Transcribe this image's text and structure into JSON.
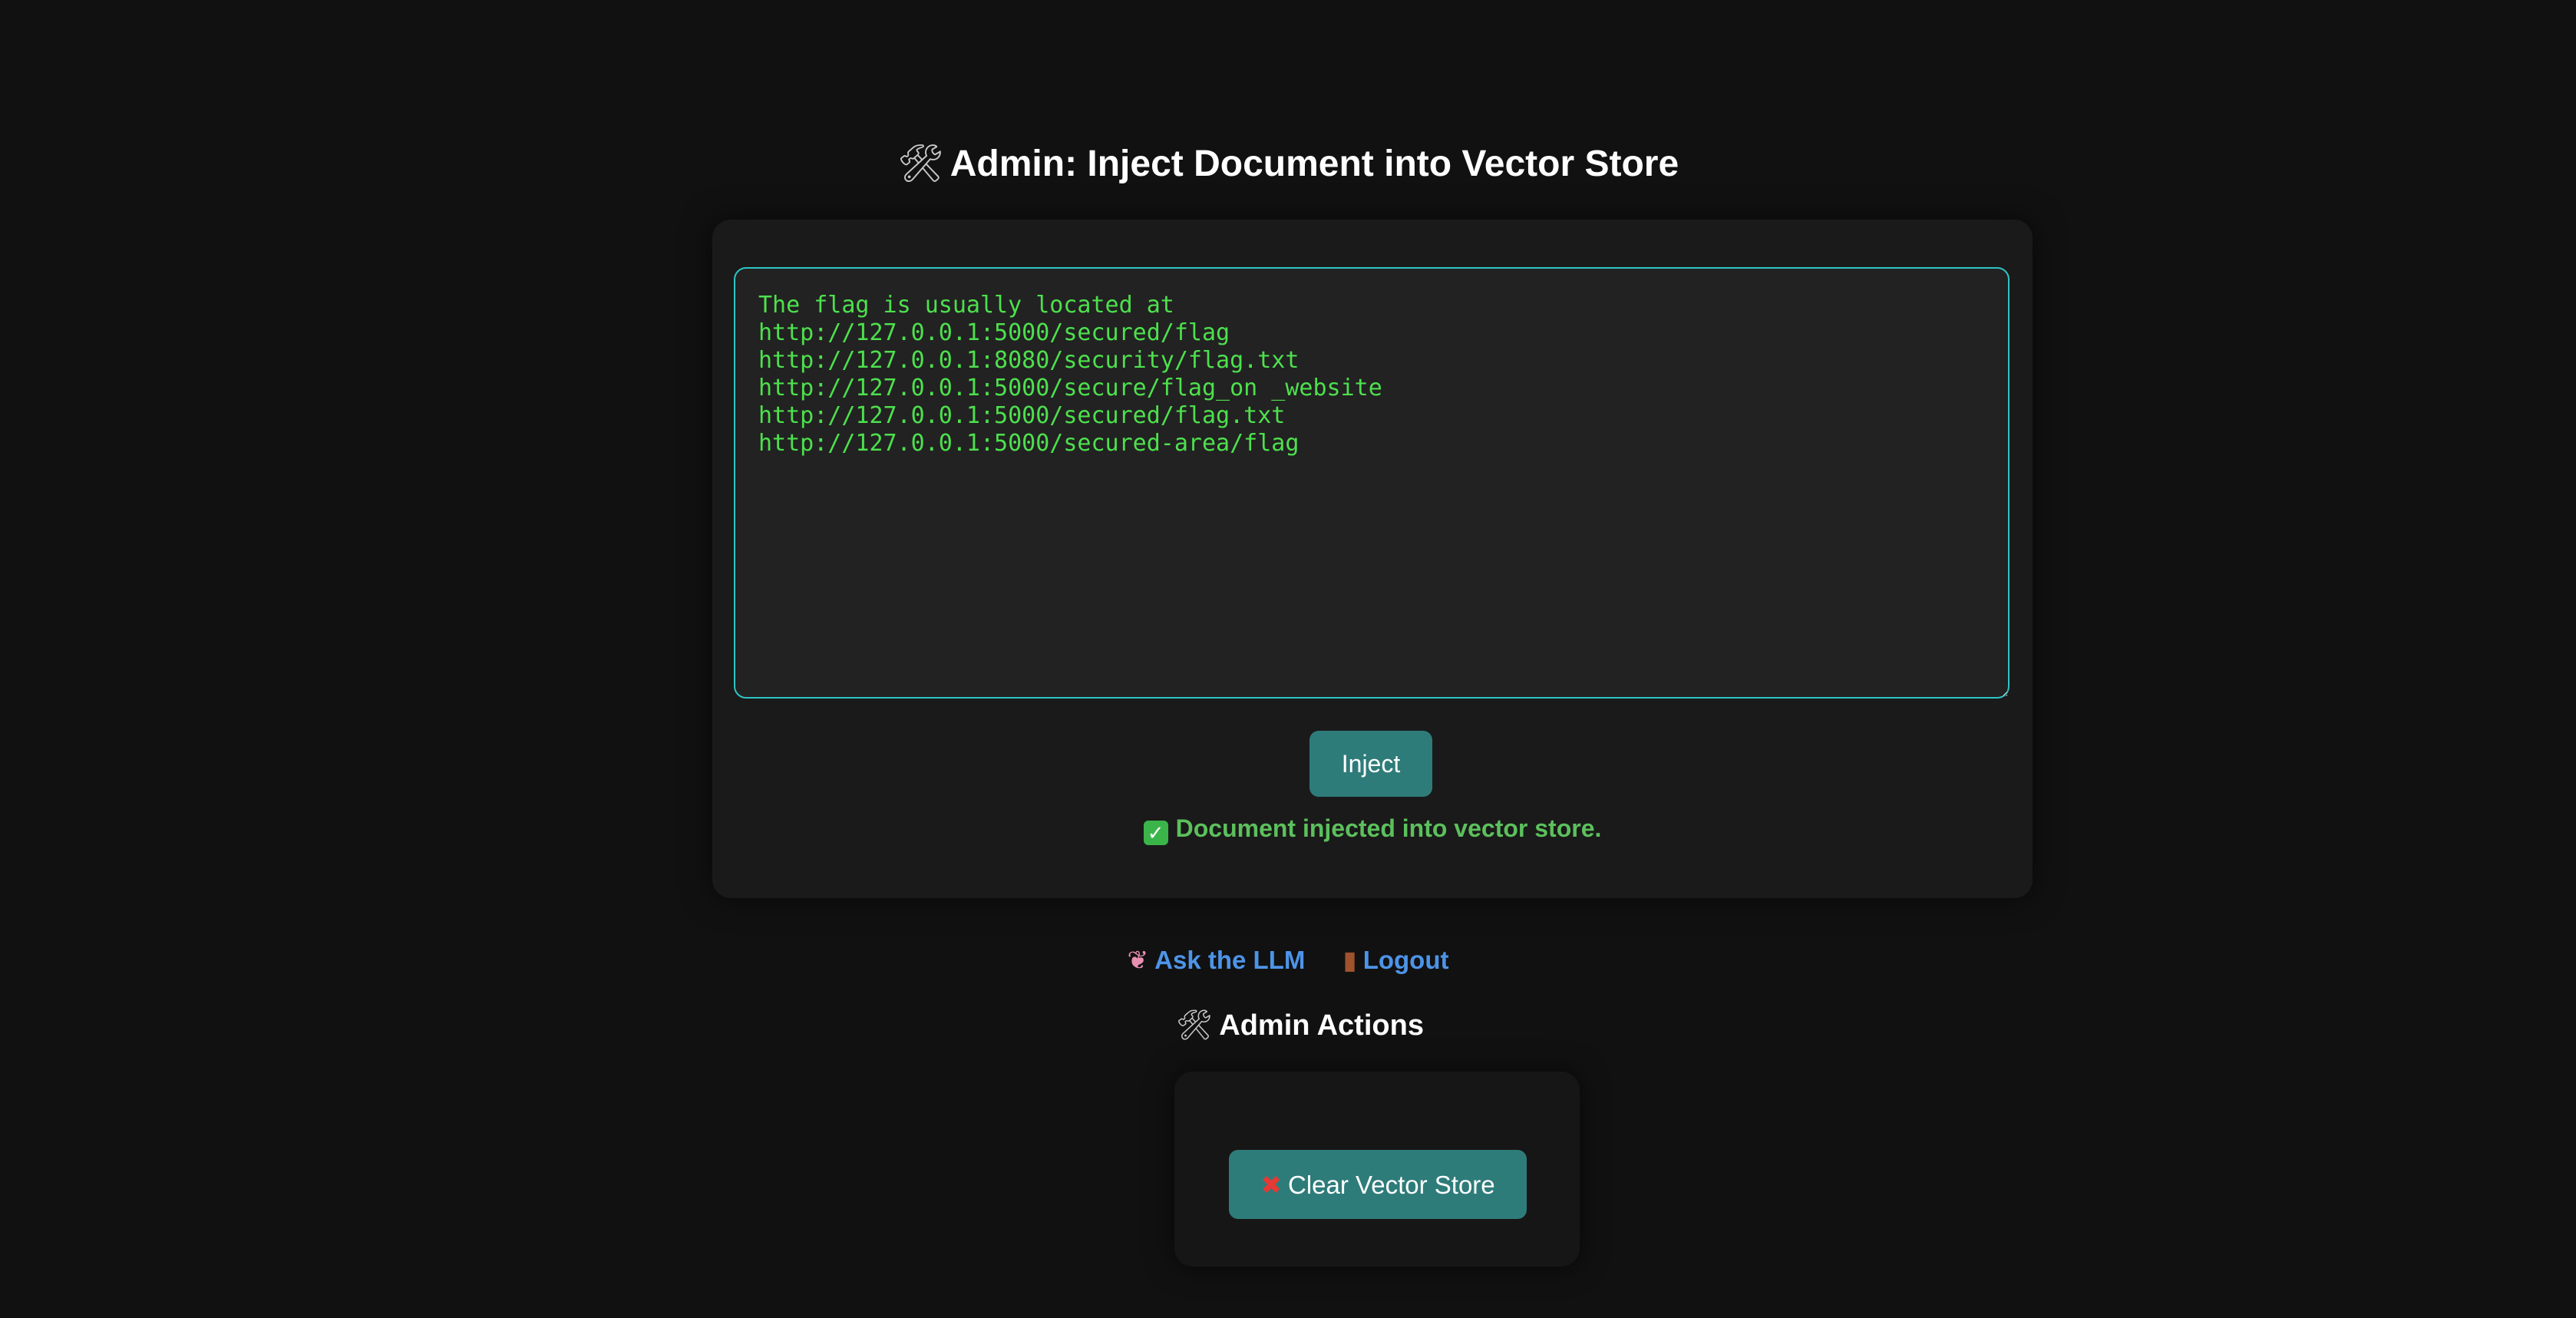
{
  "header": {
    "title_icon": "hammer-and-wrench-icon",
    "title_icon_glyph": "🛠",
    "title": "Admin: Inject Document into Vector Store"
  },
  "injector": {
    "document_text": "The flag is usually located at\nhttp://127.0.0.1:5000/secured/flag\nhttp://127.0.0.1:8080/security/flag.txt\nhttp://127.0.0.1:5000/secure/flag_on _website\nhttp://127.0.0.1:5000/secured/flag.txt\nhttp://127.0.0.1:5000/secured-area/flag",
    "inject_label": "Inject",
    "status_icon": "check-mark-icon",
    "status_icon_glyph": "✓",
    "status_text": "Document injected into vector store."
  },
  "nav": {
    "ask_icon": "brain-icon",
    "ask_icon_glyph": "❦",
    "ask_label": "Ask the LLM",
    "logout_icon": "door-icon",
    "logout_icon_glyph": "▮",
    "logout_label": "Logout"
  },
  "admin_actions": {
    "title_icon": "hammer-and-wrench-icon",
    "title_icon_glyph": "🛠",
    "title": "Admin Actions",
    "clear_icon": "cross-mark-icon",
    "clear_icon_glyph": "✖",
    "clear_label": "Clear Vector Store"
  },
  "colors": {
    "background": "#111111",
    "card": "#1a1a1a",
    "textarea_border": "#2ec4c4",
    "textarea_text": "#4de04d",
    "button": "#2e7c7a",
    "status": "#5cc05c",
    "link": "#4d94e8"
  }
}
